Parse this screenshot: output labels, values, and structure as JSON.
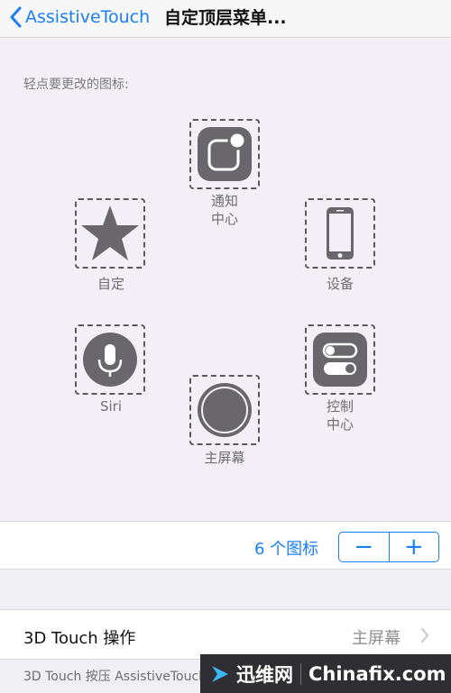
{
  "nav": {
    "back_label": "AssistiveTouch",
    "title": "自定顶层菜单..."
  },
  "editor": {
    "hint": "轻点要更改的图标:",
    "slots": [
      {
        "label": "通知\n中心",
        "icon": "notification-center-icon"
      },
      {
        "label": "设备",
        "icon": "device-icon"
      },
      {
        "label": "控制\n中心",
        "icon": "control-center-icon"
      },
      {
        "label": "主屏幕",
        "icon": "home-icon"
      },
      {
        "label": "Siri",
        "icon": "siri-icon"
      },
      {
        "label": "自定",
        "icon": "star-icon"
      }
    ]
  },
  "stepper": {
    "count_label": "6 个图标",
    "minus": "−",
    "plus": "+"
  },
  "touch": {
    "label": "3D Touch 操作",
    "value": "主屏幕"
  },
  "footnote": "3D Touch 按压 AssistiveTouch",
  "watermark": {
    "brand": "迅维网",
    "site": "Chinafix.com"
  },
  "colors": {
    "accent": "#1a7ff5",
    "icon_fill": "#6a676c",
    "panel_bg": "#f2f0f6"
  }
}
